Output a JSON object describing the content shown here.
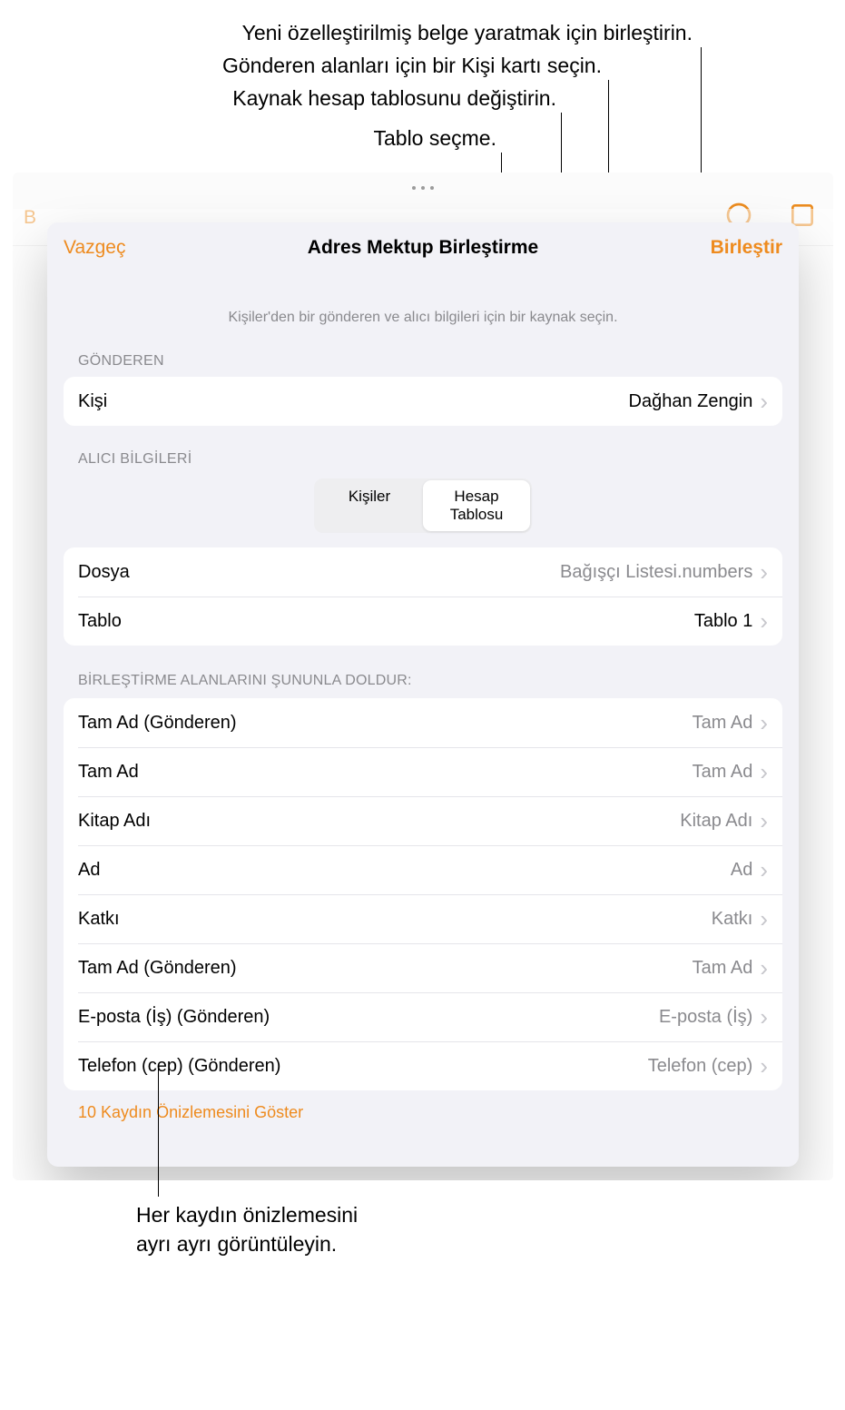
{
  "callouts": {
    "merge": "Yeni özelleştirilmiş belge yaratmak için birleştirin.",
    "contact": "Gönderen alanları için bir Kişi kartı seçin.",
    "source": "Kaynak hesap tablosunu değiştirin.",
    "table": "Tablo seçme.",
    "preview_line1": "Her kaydın önizlemesini",
    "preview_line2": "ayrı ayrı görüntüleyin."
  },
  "modal": {
    "cancel": "Vazgeç",
    "title": "Adres Mektup Birleştirme",
    "merge": "Birleştir",
    "helper": "Kişiler'den bir gönderen ve alıcı bilgileri için bir kaynak seçin."
  },
  "sender": {
    "section": "GÖNDEREN",
    "label": "Kişi",
    "value": "Dağhan Zengin"
  },
  "recipient": {
    "section": "ALICI BİLGİLERİ",
    "segments": {
      "contacts": "Kişiler",
      "spreadsheet": "Hesap Tablosu"
    },
    "file_label": "Dosya",
    "file_value": "Bağışçı Listesi.numbers",
    "table_label": "Tablo",
    "table_value": "Tablo 1"
  },
  "fields": {
    "section_label": "BİRLEŞTİRME ALANLARINI ŞUNUNLA DOLDUR:",
    "rows": [
      {
        "label": "Tam Ad (Gönderen)",
        "value": "Tam Ad"
      },
      {
        "label": "Tam Ad",
        "value": "Tam Ad"
      },
      {
        "label": "Kitap Adı",
        "value": "Kitap Adı"
      },
      {
        "label": "Ad",
        "value": "Ad"
      },
      {
        "label": "Katkı",
        "value": "Katkı"
      },
      {
        "label": "Tam Ad (Gönderen)",
        "value": "Tam Ad"
      },
      {
        "label": "E-posta (İş) (Gönderen)",
        "value": "E-posta (İş)"
      },
      {
        "label": "Telefon (cep) (Gönderen)",
        "value": "Telefon (cep)"
      }
    ]
  },
  "preview_link": "10 Kaydın Önizlemesini Göster"
}
